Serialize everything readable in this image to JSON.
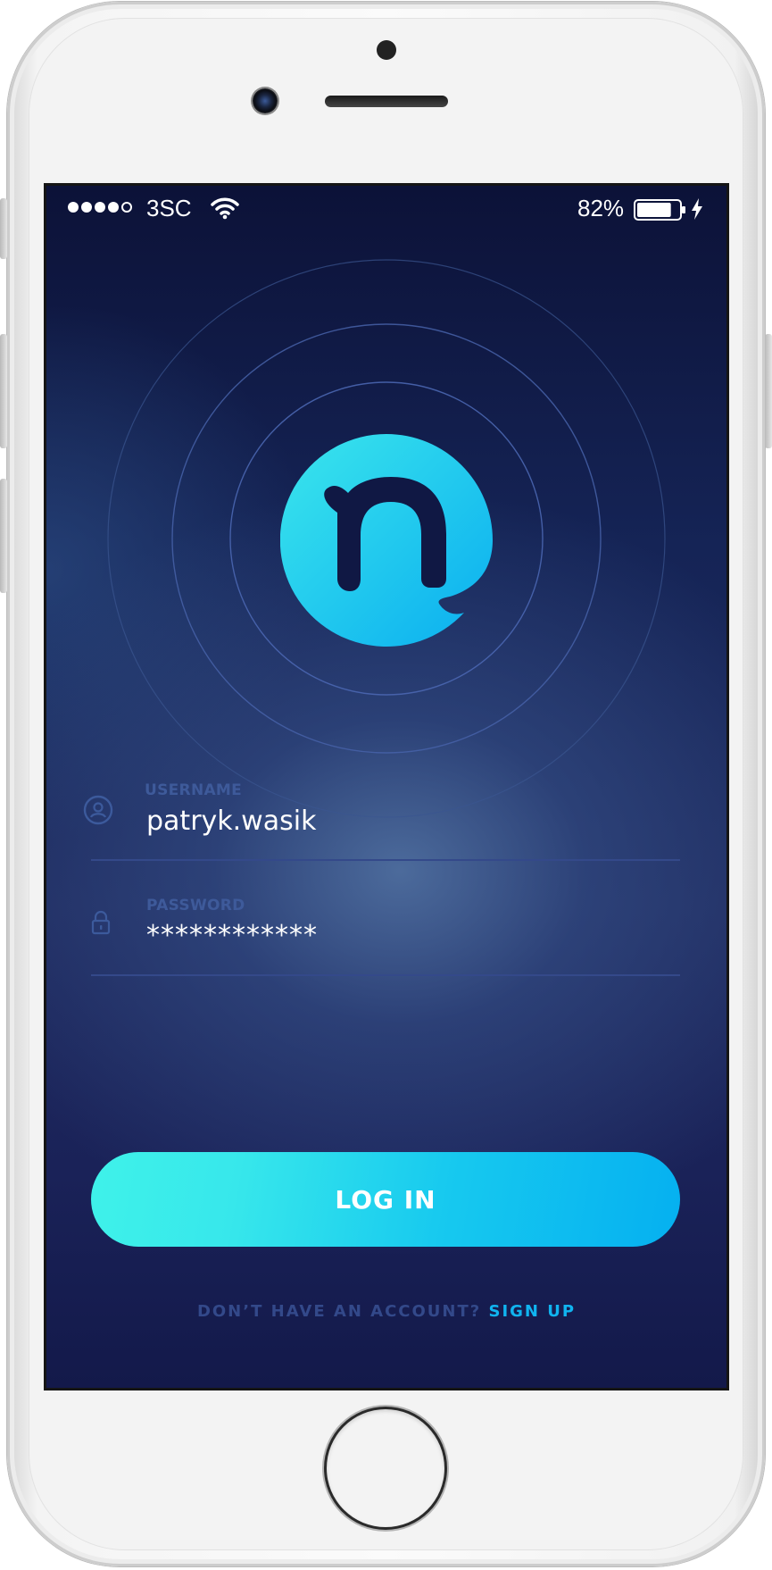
{
  "status_bar": {
    "carrier": "3SC",
    "signal_bars_filled": 4,
    "signal_bars_total": 5,
    "battery_percent": "82%",
    "battery_level": 0.82
  },
  "login_form": {
    "username": {
      "label": "USERNAME",
      "value": "patryk.wasik"
    },
    "password": {
      "label": "PASSWORD",
      "value": "************"
    },
    "login_button_label": "LOG IN"
  },
  "signup": {
    "prompt": "DON’T HAVE AN ACCOUNT?",
    "link_label": "SIGN UP"
  },
  "colors": {
    "accent": "#10b4f0",
    "accent_light": "#3ff2ea",
    "background_dark": "#0c1238",
    "muted_text": "#3e5a9a"
  },
  "icons": {
    "wifi": "wifi-icon",
    "battery": "battery-icon",
    "charging": "charging-bolt-icon",
    "user": "user-circle-icon",
    "lock": "lock-icon",
    "logo": "n-logo-icon"
  }
}
